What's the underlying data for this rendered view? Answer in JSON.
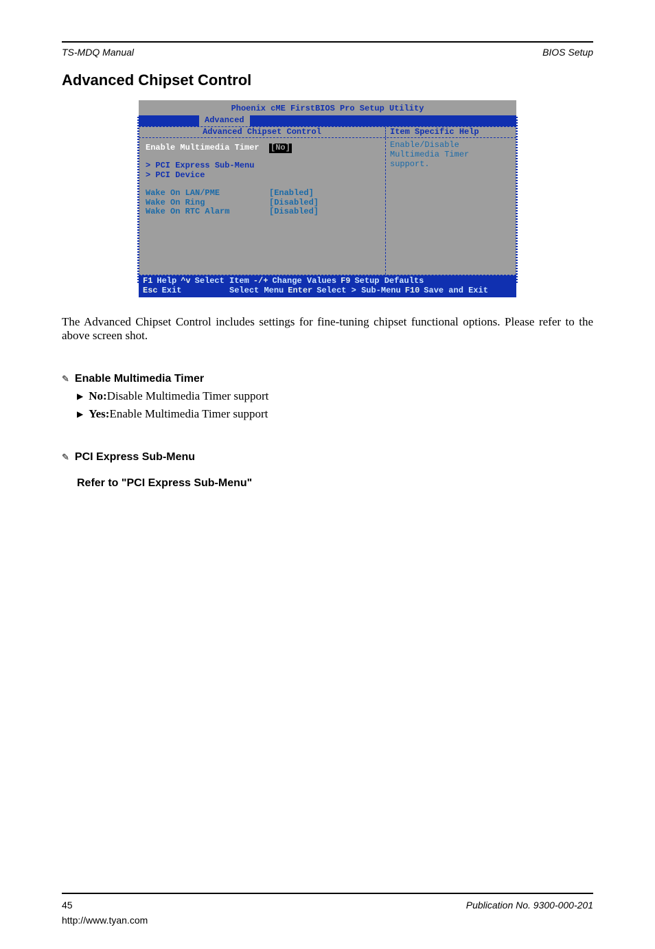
{
  "header": {
    "manual": "TS-MDQ Manual",
    "chapter": "BIOS Setup"
  },
  "section_title": "Advanced Chipset Control",
  "bios": {
    "utility_title": "Phoenix cME FirstBIOS Pro Setup Utility",
    "menu_tab": "Advanced",
    "panel_title": "Advanced Chipset Control",
    "help_title": "Item Specific Help",
    "help_text": "Enable/Disable Multimedia Timer support.",
    "items": [
      {
        "label": "Enable Multimedia Timer",
        "value": "[No]",
        "selected": true
      },
      {
        "label": "> PCI Express Sub-Menu",
        "value": "",
        "blue": true
      },
      {
        "label": "> PCI Device",
        "value": "",
        "blue": true
      },
      {
        "label": "Wake On LAN/PME",
        "value": "[Enabled]"
      },
      {
        "label": "Wake On Ring",
        "value": "[Disabled]"
      },
      {
        "label": "Wake On RTC Alarm",
        "value": "[Disabled]"
      }
    ],
    "footer": {
      "f1": "F1",
      "help": "Help",
      "arrows1": "^v",
      "sel_item": "Select Item",
      "pm": "-/+",
      "chval": "Change Values",
      "f9": "F9",
      "defaults": "Setup Defaults",
      "esc": "Esc",
      "exit": "Exit",
      "sel_menu": "Select Menu",
      "enter": "Enter",
      "sub": "Select > Sub-Menu",
      "f10": "F10",
      "save": "Save and Exit"
    }
  },
  "intro_para": "The Advanced Chipset Control includes settings for fine-tuning chipset functional options. Please refer to the above screen shot.",
  "option1": {
    "heading": "Enable Multimedia Timer",
    "line1_bold": "No:",
    "line1_rest": " Disable Multimedia Timer support",
    "line2_bold": "Yes:",
    "line2_rest": " Enable Multimedia Timer support"
  },
  "option2": {
    "heading": "PCI Express Sub-Menu",
    "refer": "Refer to \"PCI Express Sub-Menu\""
  },
  "footer": {
    "page": "45",
    "pub": "Publication No. 9300-000-201",
    "url": "http://www.tyan.com"
  }
}
